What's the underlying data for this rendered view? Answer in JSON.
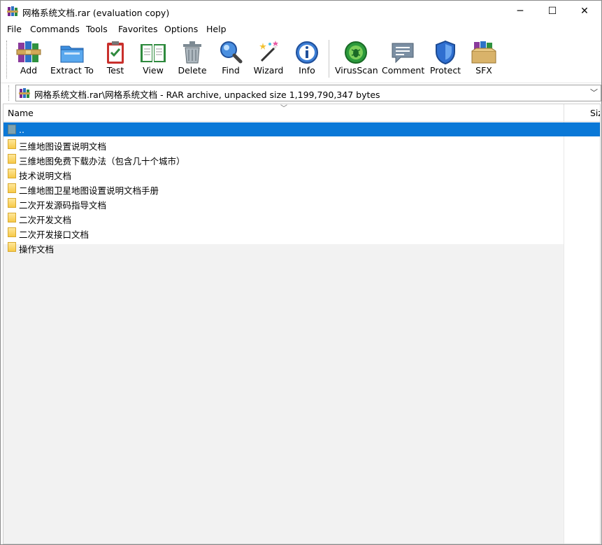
{
  "window": {
    "title": "网格系统文档.rar (evaluation copy)",
    "minimize_glyph": "─",
    "maximize_glyph": "☐",
    "close_glyph": "✕"
  },
  "menu": [
    "File",
    "Commands",
    "Tools",
    "Favorites",
    "Options",
    "Help"
  ],
  "toolbar": [
    {
      "label": "Add",
      "icon": "winrar-books-icon"
    },
    {
      "label": "Extract To",
      "icon": "folder-extract-icon"
    },
    {
      "label": "Test",
      "icon": "clipboard-check-icon"
    },
    {
      "label": "View",
      "icon": "open-book-icon"
    },
    {
      "label": "Delete",
      "icon": "trash-can-icon"
    },
    {
      "label": "Find",
      "icon": "magnifier-icon"
    },
    {
      "label": "Wizard",
      "icon": "magic-wand-icon"
    },
    {
      "label": "Info",
      "icon": "info-icon"
    },
    {
      "label": "VirusScan",
      "icon": "virus-scan-icon"
    },
    {
      "label": "Comment",
      "icon": "comment-icon"
    },
    {
      "label": "Protect",
      "icon": "shield-icon"
    },
    {
      "label": "SFX",
      "icon": "sfx-box-icon"
    }
  ],
  "address": {
    "path": "网格系统文档.rar\\网格系统文档 - RAR archive, unpacked size 1,199,790,347 bytes"
  },
  "columns": {
    "name": "Name",
    "size": "Siz"
  },
  "rows": [
    {
      "name": "..",
      "type": "updir",
      "selected": true
    },
    {
      "name": "三维地图设置说明文档",
      "type": "folder"
    },
    {
      "name": "三维地图免费下载办法（包含几十个城市）",
      "type": "folder"
    },
    {
      "name": "技术说明文档",
      "type": "folder"
    },
    {
      "name": "二维地图卫星地图设置说明文档手册",
      "type": "folder"
    },
    {
      "name": "二次开发源码指导文档",
      "type": "folder"
    },
    {
      "name": "二次开发文档",
      "type": "folder"
    },
    {
      "name": "二次开发接口文档",
      "type": "folder"
    },
    {
      "name": "操作文档",
      "type": "folder"
    }
  ],
  "colors": {
    "selection": "#0a78d7"
  }
}
